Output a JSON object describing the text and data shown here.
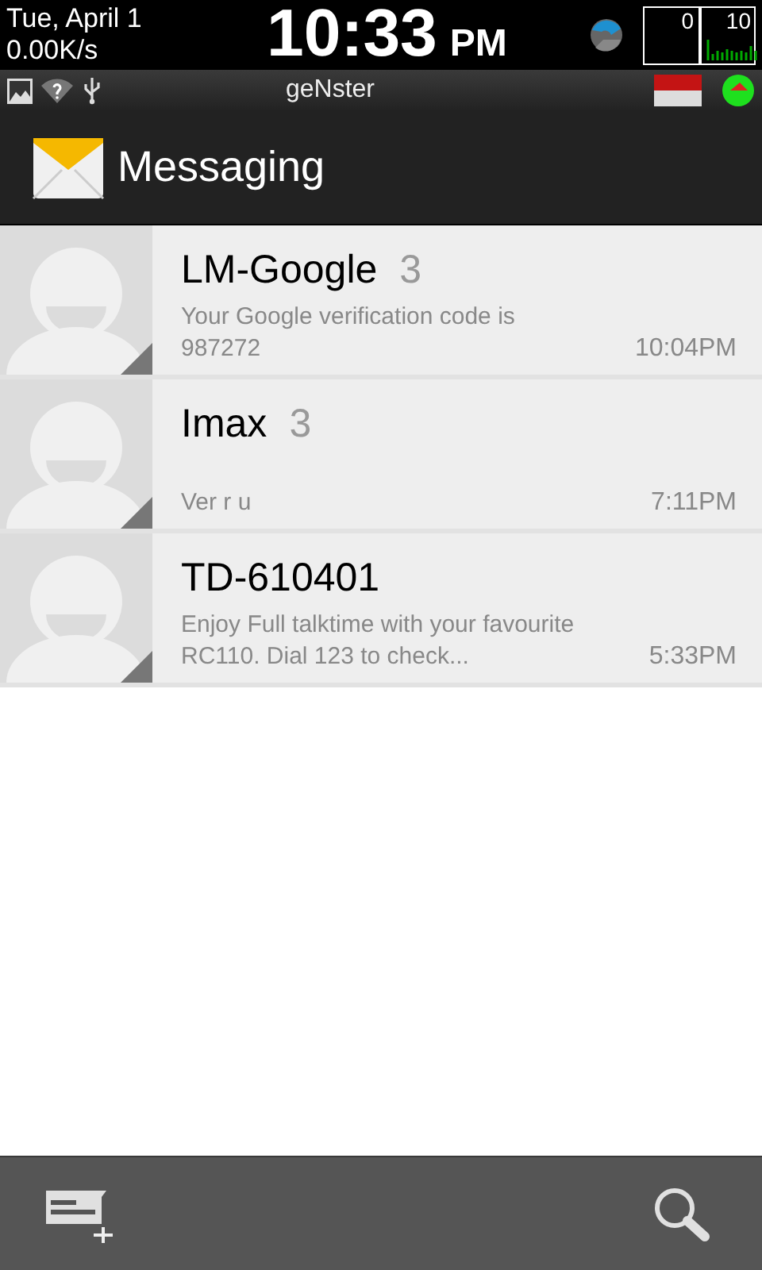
{
  "status_bar": {
    "date": "Tue, April 1",
    "speed": "0.00K/s",
    "time": "10:33",
    "ampm": "PM",
    "meter_labels": [
      "0",
      "10"
    ],
    "carrier": "geNster"
  },
  "action_bar": {
    "title": "Messaging"
  },
  "conversations": [
    {
      "name": "LM-Google",
      "count": "3",
      "snippet": "Your Google verification code is 987272",
      "time": "10:04PM"
    },
    {
      "name": "Imax",
      "count": "3",
      "snippet": "Ver r u",
      "time": "7:11PM"
    },
    {
      "name": "TD-610401",
      "snippet": "Enjoy Full talktime with your favourite RC110. Dial 123 to check...",
      "time": "5:33PM"
    }
  ]
}
